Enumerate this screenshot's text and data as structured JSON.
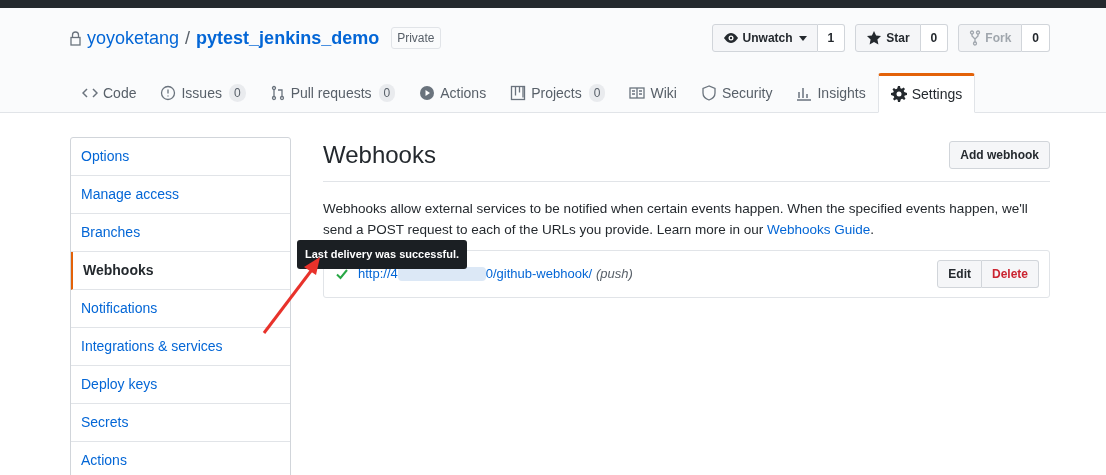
{
  "repo": {
    "owner": "yoyoketang",
    "separator": "/",
    "name": "pytest_jenkins_demo",
    "visibility": "Private"
  },
  "actions": [
    {
      "kind": "watch",
      "label": "Unwatch",
      "count": "1",
      "disabled": false
    },
    {
      "kind": "star",
      "label": "Star",
      "count": "0",
      "disabled": false
    },
    {
      "kind": "fork",
      "label": "Fork",
      "count": "0",
      "disabled": true
    }
  ],
  "tabs": [
    {
      "kind": "code",
      "label": "Code",
      "selected": false
    },
    {
      "kind": "issues",
      "label": "Issues",
      "count": "0",
      "selected": false
    },
    {
      "kind": "pulls",
      "label": "Pull requests",
      "count": "0",
      "selected": false
    },
    {
      "kind": "actions",
      "label": "Actions",
      "selected": false
    },
    {
      "kind": "projects",
      "label": "Projects",
      "count": "0",
      "selected": false
    },
    {
      "kind": "wiki",
      "label": "Wiki",
      "selected": false
    },
    {
      "kind": "security",
      "label": "Security",
      "selected": false
    },
    {
      "kind": "insights",
      "label": "Insights",
      "selected": false
    },
    {
      "kind": "settings",
      "label": "Settings",
      "selected": true
    }
  ],
  "sidebar": {
    "items": [
      {
        "label": "Options",
        "selected": false
      },
      {
        "label": "Manage access",
        "selected": false
      },
      {
        "label": "Branches",
        "selected": false
      },
      {
        "label": "Webhooks",
        "selected": true
      },
      {
        "label": "Notifications",
        "selected": false
      },
      {
        "label": "Integrations & services",
        "selected": false
      },
      {
        "label": "Deploy keys",
        "selected": false
      },
      {
        "label": "Secrets",
        "selected": false
      },
      {
        "label": "Actions",
        "selected": false
      }
    ]
  },
  "main": {
    "title": "Webhooks",
    "add_button": "Add webhook",
    "description": "Webhooks allow external services to be notified when certain events happen. When the specified events happen, we'll send a POST request to each of the URLs you provide. Learn more in our ",
    "guide_link": "Webhooks Guide",
    "description_end": ".",
    "hooks": [
      {
        "url_start": "http://4",
        "url_end": "0/github-webhook/",
        "events": "(push)",
        "success": true,
        "edit": "Edit",
        "delete": "Delete"
      }
    ],
    "tooltip": "Last delivery was successful."
  }
}
